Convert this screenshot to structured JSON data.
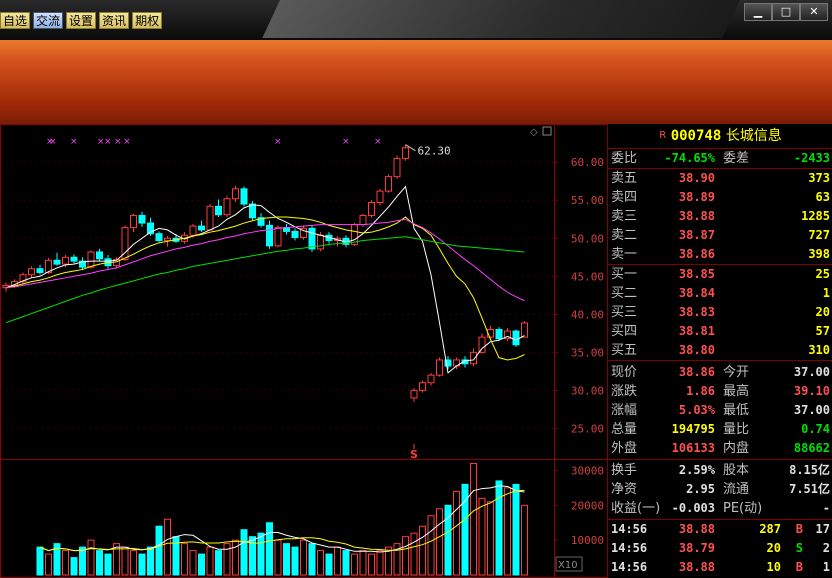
{
  "menu": [
    {
      "label": "自选",
      "active": false
    },
    {
      "label": "交流",
      "active": true
    },
    {
      "label": "设置",
      "active": false
    },
    {
      "label": "资讯",
      "active": false
    },
    {
      "label": "期权",
      "active": false
    }
  ],
  "window_controls": [
    "▁",
    "□",
    "✕"
  ],
  "stock": {
    "flag": "R",
    "code": "000748",
    "name": "长城信息"
  },
  "order_ratio": {
    "label1": "委比",
    "val1": "-74.65%",
    "label2": "委差",
    "val2": "-2433"
  },
  "asks": [
    {
      "label": "卖五",
      "price": "38.90",
      "vol": "373"
    },
    {
      "label": "卖四",
      "price": "38.89",
      "vol": "63"
    },
    {
      "label": "卖三",
      "price": "38.88",
      "vol": "1285"
    },
    {
      "label": "卖二",
      "price": "38.87",
      "vol": "727"
    },
    {
      "label": "卖一",
      "price": "38.86",
      "vol": "398"
    }
  ],
  "bids": [
    {
      "label": "买一",
      "price": "38.85",
      "vol": "25"
    },
    {
      "label": "买二",
      "price": "38.84",
      "vol": "1"
    },
    {
      "label": "买三",
      "price": "38.83",
      "vol": "20"
    },
    {
      "label": "买四",
      "price": "38.81",
      "vol": "57"
    },
    {
      "label": "买五",
      "price": "38.80",
      "vol": "310"
    }
  ],
  "quote": [
    {
      "l1": "现价",
      "v1": "38.86",
      "c1": "red",
      "l2": "今开",
      "v2": "37.00",
      "c2": "white"
    },
    {
      "l1": "涨跌",
      "v1": "1.86",
      "c1": "red",
      "l2": "最高",
      "v2": "39.10",
      "c2": "red"
    },
    {
      "l1": "涨幅",
      "v1": "5.03%",
      "c1": "red",
      "l2": "最低",
      "v2": "37.00",
      "c2": "white"
    },
    {
      "l1": "总量",
      "v1": "194795",
      "c1": "yellow",
      "l2": "量比",
      "v2": "0.74",
      "c2": "green"
    },
    {
      "l1": "外盘",
      "v1": "106133",
      "c1": "red",
      "l2": "内盘",
      "v2": "88662",
      "c2": "green"
    }
  ],
  "fundamentals": [
    {
      "l1": "换手",
      "v1": "2.59%",
      "l2": "股本",
      "v2": "8.15亿"
    },
    {
      "l1": "净资",
      "v1": "2.95",
      "l2": "流通",
      "v2": "7.51亿"
    },
    {
      "l1": "收益(一)",
      "v1": "-0.003",
      "l2": "PE(动)",
      "v2": "-"
    }
  ],
  "ticks": [
    {
      "time": "14:56",
      "price": "38.88",
      "price_color": "red",
      "vol": "287",
      "side": "B",
      "side_color": "red",
      "n": "17"
    },
    {
      "time": "14:56",
      "price": "38.79",
      "price_color": "red",
      "vol": "20",
      "side": "S",
      "side_color": "green",
      "n": "2"
    },
    {
      "time": "14:56",
      "price": "38.88",
      "price_color": "red",
      "vol": "10",
      "side": "B",
      "side_color": "red",
      "n": "1"
    }
  ],
  "chart_data": {
    "type": "candlestick",
    "price_axis": {
      "ticks": [
        "60.00",
        "55.00",
        "50.00",
        "45.00",
        "40.00",
        "35.00",
        "30.00",
        "25.00"
      ],
      "min": 21.5,
      "max": 64.5
    },
    "volume_axis": {
      "ticks": [
        "30000",
        "20000",
        "10000"
      ],
      "unit_label": "X10",
      "max": 33000
    },
    "annotations": {
      "high_label": "62.30",
      "event_marker": "S"
    },
    "candles": [
      [
        43.5,
        44.2,
        43.0,
        43.8
      ],
      [
        43.8,
        44.6,
        43.5,
        44.3
      ],
      [
        44.3,
        45.5,
        44.0,
        45.2
      ],
      [
        45.2,
        46.3,
        44.8,
        46.0
      ],
      [
        46.0,
        46.5,
        45.2,
        45.5
      ],
      [
        45.5,
        47.4,
        45.3,
        47.1
      ],
      [
        47.1,
        48.1,
        46.4,
        46.6
      ],
      [
        46.6,
        47.8,
        46.2,
        47.5
      ],
      [
        47.5,
        47.9,
        46.7,
        47.0
      ],
      [
        47.0,
        47.5,
        45.8,
        46.2
      ],
      [
        46.2,
        48.4,
        46.0,
        48.2
      ],
      [
        48.2,
        48.6,
        47.0,
        47.3
      ],
      [
        47.3,
        47.8,
        46.0,
        46.4
      ],
      [
        46.4,
        47.5,
        46.0,
        47.2
      ],
      [
        47.2,
        51.7,
        47.0,
        51.4
      ],
      [
        51.4,
        53.2,
        50.8,
        53.0
      ],
      [
        53.0,
        53.5,
        51.5,
        52.0
      ],
      [
        52.0,
        52.7,
        50.3,
        50.6
      ],
      [
        50.6,
        50.9,
        49.5,
        49.7
      ],
      [
        49.7,
        50.3,
        48.9,
        50.0
      ],
      [
        50.0,
        50.6,
        49.4,
        49.6
      ],
      [
        49.6,
        50.8,
        49.3,
        50.4
      ],
      [
        50.4,
        51.9,
        50.1,
        51.6
      ],
      [
        51.6,
        52.3,
        50.8,
        51.1
      ],
      [
        51.1,
        54.5,
        51.0,
        54.2
      ],
      [
        54.2,
        55.1,
        52.8,
        53.1
      ],
      [
        53.1,
        55.6,
        52.8,
        55.2
      ],
      [
        55.2,
        56.9,
        54.8,
        56.5
      ],
      [
        56.5,
        56.8,
        54.2,
        54.5
      ],
      [
        54.5,
        54.9,
        52.4,
        52.7
      ],
      [
        52.7,
        53.3,
        51.4,
        51.7
      ],
      [
        51.7,
        52.3,
        48.6,
        49.0
      ],
      [
        49.0,
        51.7,
        48.8,
        51.4
      ],
      [
        51.4,
        51.9,
        50.5,
        50.9
      ],
      [
        50.9,
        51.3,
        49.7,
        50.1
      ],
      [
        50.1,
        51.7,
        49.8,
        51.3
      ],
      [
        51.3,
        51.7,
        48.2,
        48.6
      ],
      [
        48.6,
        50.8,
        48.3,
        50.4
      ],
      [
        50.4,
        50.8,
        49.3,
        49.7
      ],
      [
        49.7,
        50.3,
        48.9,
        50.0
      ],
      [
        50.0,
        50.4,
        48.8,
        49.2
      ],
      [
        49.2,
        52.0,
        49.0,
        51.8
      ],
      [
        51.8,
        53.2,
        51.5,
        53.0
      ],
      [
        53.0,
        55.0,
        52.7,
        54.7
      ],
      [
        54.7,
        56.5,
        54.3,
        56.2
      ],
      [
        56.2,
        58.4,
        56.0,
        58.1
      ],
      [
        58.1,
        60.9,
        57.8,
        60.5
      ],
      [
        60.5,
        62.3,
        60.2,
        61.9
      ],
      [
        29.0,
        30.3,
        28.5,
        30.0
      ],
      [
        30.0,
        31.3,
        29.7,
        31.0
      ],
      [
        31.0,
        32.3,
        30.6,
        32.0
      ],
      [
        32.0,
        34.3,
        31.8,
        34.0
      ],
      [
        34.0,
        34.5,
        32.8,
        33.2
      ],
      [
        33.2,
        34.3,
        32.8,
        34.0
      ],
      [
        34.0,
        34.5,
        33.0,
        33.5
      ],
      [
        33.5,
        35.5,
        33.2,
        35.0
      ],
      [
        35.0,
        37.5,
        34.8,
        37.0
      ],
      [
        37.0,
        38.5,
        36.6,
        38.0
      ],
      [
        38.0,
        38.3,
        36.5,
        36.8
      ],
      [
        36.8,
        38.2,
        36.5,
        37.8
      ],
      [
        37.8,
        38.0,
        35.7,
        36.0
      ],
      [
        37.0,
        39.1,
        37.0,
        38.86
      ]
    ],
    "volumes": [
      8,
      6,
      9,
      7,
      5,
      8,
      10,
      7,
      6,
      9,
      8,
      7,
      6,
      8,
      14,
      16,
      11,
      9,
      7,
      6,
      8,
      7,
      9,
      10,
      13,
      11,
      12,
      15,
      10,
      9,
      8,
      10,
      9,
      7,
      6,
      8,
      7,
      6,
      7,
      6,
      7,
      8,
      9,
      11,
      12,
      14,
      17,
      19,
      20,
      24,
      26,
      32,
      22,
      21,
      27,
      25,
      26,
      20
    ],
    "ma_lines": [
      {
        "name": "MA5",
        "color": "#ffffff",
        "values": [
          43.5,
          43.9,
          44.4,
          44.8,
          45.0,
          45.6,
          46.1,
          46.5,
          46.6,
          46.9,
          47.0,
          47.0,
          47.0,
          47.1,
          48.1,
          49.2,
          50.0,
          50.8,
          51.3,
          51.1,
          50.4,
          49.9,
          50.3,
          50.6,
          51.1,
          51.6,
          52.5,
          53.1,
          54.0,
          54.4,
          54.3,
          53.4,
          52.6,
          52.1,
          51.5,
          51.0,
          50.7,
          50.4,
          50.1,
          49.8,
          49.5,
          49.8,
          50.6,
          51.7,
          52.9,
          54.1,
          55.5,
          56.8,
          51.3,
          49.6,
          45.2,
          38.9,
          32.3,
          33.2,
          33.9,
          34.0,
          35.5,
          36.4,
          36.6,
          37.1,
          36.6,
          37.2
        ]
      },
      {
        "name": "MA10",
        "color": "#ffff00",
        "values": [
          43.5,
          43.7,
          44.0,
          44.3,
          44.5,
          44.8,
          45.2,
          45.5,
          45.7,
          45.9,
          46.3,
          46.6,
          46.8,
          46.9,
          47.4,
          47.9,
          48.5,
          49.0,
          49.4,
          49.6,
          49.8,
          50.0,
          50.3,
          50.5,
          50.8,
          51.0,
          51.3,
          51.6,
          52.0,
          52.3,
          52.6,
          52.7,
          52.8,
          52.8,
          52.7,
          52.6,
          52.4,
          52.1,
          51.7,
          51.4,
          51.1,
          50.9,
          50.7,
          50.8,
          51.1,
          51.5,
          52.0,
          52.8,
          51.8,
          51.3,
          50.4,
          48.6,
          46.7,
          45.0,
          44.0,
          42.2,
          39.5,
          36.7,
          34.3,
          34.0,
          34.2,
          34.7
        ]
      },
      {
        "name": "MA20",
        "color": "#ff40ff",
        "values": [
          43.5,
          43.6,
          43.8,
          44.0,
          44.2,
          44.4,
          44.6,
          44.8,
          45.0,
          45.2,
          45.4,
          45.7,
          45.9,
          46.1,
          46.5,
          46.9,
          47.3,
          47.7,
          48.0,
          48.3,
          48.6,
          48.8,
          49.1,
          49.3,
          49.6,
          49.8,
          50.1,
          50.3,
          50.6,
          50.8,
          51.0,
          51.1,
          51.3,
          51.4,
          51.5,
          51.6,
          51.7,
          51.8,
          51.8,
          51.8,
          51.8,
          51.8,
          51.8,
          51.9,
          52.0,
          52.1,
          52.3,
          52.5,
          51.9,
          51.4,
          50.7,
          49.9,
          49.0,
          48.1,
          47.2,
          46.4,
          45.5,
          44.6,
          43.7,
          42.9,
          42.3,
          41.8
        ]
      },
      {
        "name": "MA60",
        "color": "#00e000",
        "values": [
          38.9,
          39.3,
          39.7,
          40.1,
          40.5,
          40.9,
          41.3,
          41.7,
          42.1,
          42.5,
          42.8,
          43.2,
          43.5,
          43.8,
          44.1,
          44.4,
          44.7,
          45.0,
          45.3,
          45.5,
          45.8,
          46.0,
          46.3,
          46.5,
          46.7,
          46.9,
          47.1,
          47.3,
          47.5,
          47.7,
          47.9,
          48.1,
          48.3,
          48.4,
          48.6,
          48.7,
          48.9,
          49.0,
          49.2,
          49.3,
          49.4,
          49.5,
          49.7,
          49.8,
          49.9,
          50.0,
          50.1,
          50.2,
          50.0,
          49.8,
          49.6,
          49.4,
          49.2,
          49.0,
          48.9,
          48.8,
          48.7,
          48.6,
          48.5,
          48.4,
          48.3,
          48.2
        ]
      }
    ]
  }
}
